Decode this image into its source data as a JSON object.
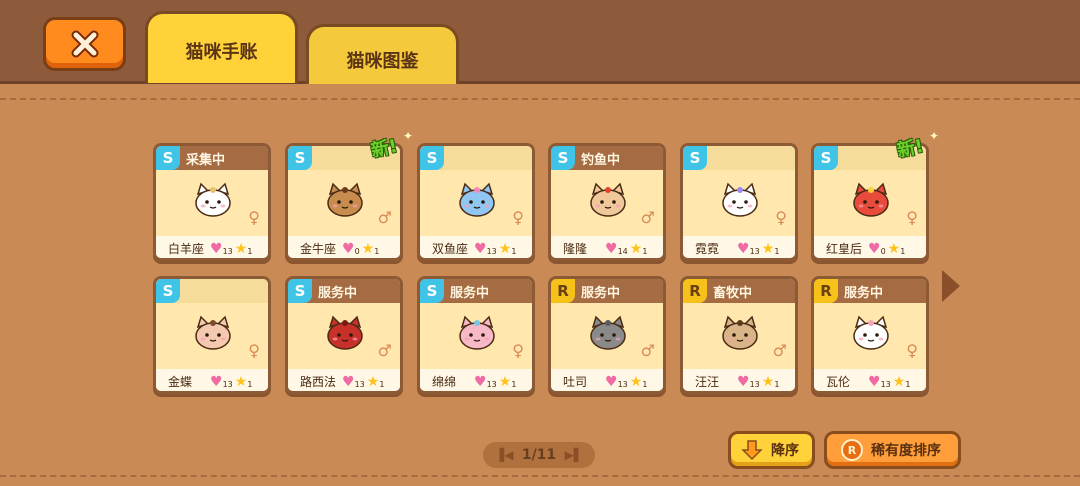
{
  "tabs": {
    "journal_label": "猫咪手账",
    "album_label": "猫咪图鉴"
  },
  "new_label": "新!",
  "cards": [
    {
      "rank": "S",
      "status": "采集中",
      "name": "白羊座",
      "hearts": "13",
      "stars": "1",
      "gender": "♀",
      "is_new": false,
      "cat_color": "#ffffff",
      "accent": "#e9c16a"
    },
    {
      "rank": "S",
      "status": "",
      "name": "金牛座",
      "hearts": "0",
      "stars": "1",
      "gender": "♂",
      "is_new": true,
      "cat_color": "#c88d4e",
      "accent": "#6a3a1a"
    },
    {
      "rank": "S",
      "status": "",
      "name": "双鱼座",
      "hearts": "13",
      "stars": "1",
      "gender": "♀",
      "is_new": false,
      "cat_color": "#8fc6f2",
      "accent": "#f08bb8"
    },
    {
      "rank": "S",
      "status": "钓鱼中",
      "name": "隆隆",
      "hearts": "14",
      "stars": "1",
      "gender": "♂",
      "is_new": false,
      "cat_color": "#f1c89a",
      "accent": "#e2432c"
    },
    {
      "rank": "S",
      "status": "",
      "name": "霓霓",
      "hearts": "13",
      "stars": "1",
      "gender": "♀",
      "is_new": false,
      "cat_color": "#ffffff",
      "accent": "#9c8cf0"
    },
    {
      "rank": "S",
      "status": "",
      "name": "红皇后",
      "hearts": "0",
      "stars": "1",
      "gender": "♀",
      "is_new": true,
      "cat_color": "#e84a3c",
      "accent": "#ffd23a"
    },
    {
      "rank": "S",
      "status": "",
      "name": "金蝶",
      "hearts": "13",
      "stars": "1",
      "gender": "♀",
      "is_new": false,
      "cat_color": "#f5c9b0",
      "accent": "#7a4a2a"
    },
    {
      "rank": "S",
      "status": "服务中",
      "name": "路西法",
      "hearts": "13",
      "stars": "1",
      "gender": "♂",
      "is_new": false,
      "cat_color": "#c8302a",
      "accent": "#7a1a14"
    },
    {
      "rank": "S",
      "status": "服务中",
      "name": "绵绵",
      "hearts": "13",
      "stars": "1",
      "gender": "♀",
      "is_new": false,
      "cat_color": "#f7b8c8",
      "accent": "#7cc7e0"
    },
    {
      "rank": "R",
      "status": "服务中",
      "name": "吐司",
      "hearts": "13",
      "stars": "1",
      "gender": "♂",
      "is_new": false,
      "cat_color": "#8a8a8a",
      "accent": "#5a5a5a"
    },
    {
      "rank": "R",
      "status": "畜牧中",
      "name": "汪汪",
      "hearts": "13",
      "stars": "1",
      "gender": "♂",
      "is_new": false,
      "cat_color": "#d8b488",
      "accent": "#5a3a1a"
    },
    {
      "rank": "R",
      "status": "服务中",
      "name": "瓦伦",
      "hearts": "13",
      "stars": "1",
      "gender": "♀",
      "is_new": false,
      "cat_color": "#ffffff",
      "accent": "#f3a4b8"
    }
  ],
  "pager": {
    "text": "1/11"
  },
  "buttons": {
    "sort_desc_label": "降序",
    "sort_rarity_label": "稀有度排序",
    "rarity_icon": "R"
  }
}
